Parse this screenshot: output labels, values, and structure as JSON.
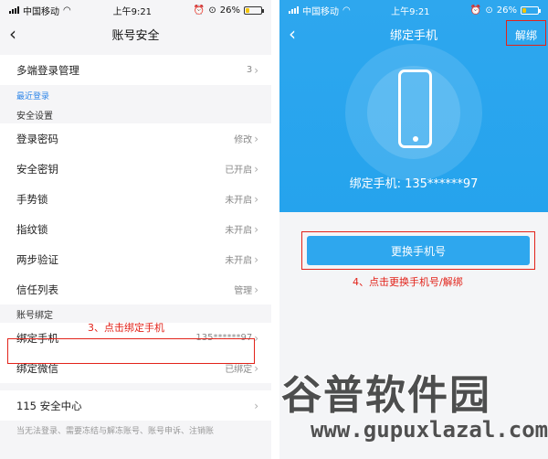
{
  "left": {
    "status": {
      "carrier": "中国移动",
      "time": "上午9:21",
      "battery": "26%"
    },
    "title": "账号安全",
    "multi_login": {
      "label": "多端登录管理",
      "value": "3"
    },
    "recent_login": "最近登录",
    "security_header": "安全设置",
    "security_items": [
      {
        "label": "登录密码",
        "value": "修改"
      },
      {
        "label": "安全密钥",
        "value": "已开启"
      },
      {
        "label": "手势锁",
        "value": "未开启"
      },
      {
        "label": "指纹锁",
        "value": "未开启"
      },
      {
        "label": "两步验证",
        "value": "未开启"
      },
      {
        "label": "信任列表",
        "value": "管理"
      }
    ],
    "binding_header": "账号绑定",
    "annotation": "3、点击绑定手机",
    "bind_phone": {
      "label": "绑定手机",
      "value": "135******97"
    },
    "bind_wechat": {
      "label": "绑定微信",
      "value": "已绑定"
    },
    "security_center": {
      "label": "115 安全中心"
    },
    "bottom_note": "当无法登录、需要冻结与解冻账号、账号申诉、注销账"
  },
  "right": {
    "status": {
      "carrier": "中国移动",
      "time": "上午9:21",
      "battery": "26%"
    },
    "title": "绑定手机",
    "unbind": "解绑",
    "phone_text": "绑定手机: 135******97",
    "change_button": "更换手机号",
    "annotation": "4、点击更换手机号/解绑"
  },
  "watermark": {
    "cn": "谷普软件园",
    "en": "www.gupuxlazal.com"
  },
  "colors": {
    "accent": "#2ea7ee",
    "annotation": "#e2231a"
  }
}
